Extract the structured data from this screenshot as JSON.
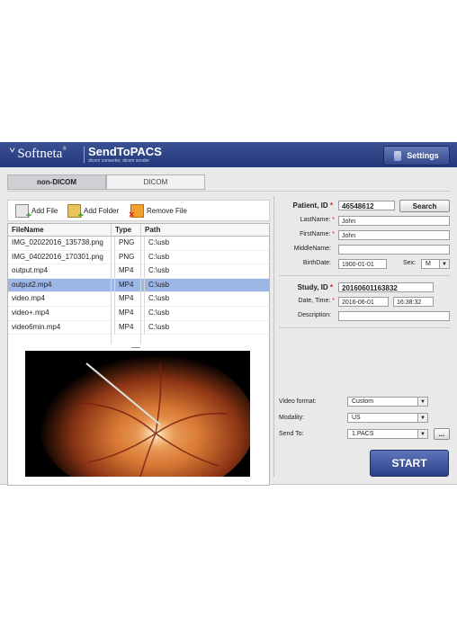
{
  "header": {
    "brand": "Softneta",
    "product": "SendToPACS",
    "product_sub": "dicom converter, dicom sender",
    "settings_label": "Settings"
  },
  "tabs": [
    {
      "label": "non-DICOM",
      "active": true
    },
    {
      "label": "DICOM",
      "active": false
    }
  ],
  "toolbar": {
    "add_file": "Add File",
    "add_folder": "Add Folder",
    "remove_file": "Remove File"
  },
  "table": {
    "headers": [
      "FileName",
      "Type",
      "Path"
    ],
    "rows": [
      {
        "name": "IMG_02022016_135738.png",
        "type": "PNG",
        "path": "C:\\usb",
        "selected": false
      },
      {
        "name": "IMG_04022016_170301.png",
        "type": "PNG",
        "path": "C:\\usb",
        "selected": false
      },
      {
        "name": "output.mp4",
        "type": "MP4",
        "path": "C:\\usb",
        "selected": false
      },
      {
        "name": "output2.mp4",
        "type": "MP4",
        "path": "C:\\usb",
        "selected": true
      },
      {
        "name": "video.mp4",
        "type": "MP4",
        "path": "C:\\usb",
        "selected": false
      },
      {
        "name": "video+.mp4",
        "type": "MP4",
        "path": "C:\\usb",
        "selected": false
      },
      {
        "name": "video6min.mp4",
        "type": "MP4",
        "path": "C:\\usb",
        "selected": false
      }
    ]
  },
  "patient": {
    "id_label": "Patient, ID",
    "id_value": "46548612",
    "search_label": "Search",
    "lastname_label": "LastName:",
    "lastname_value": "John",
    "firstname_label": "FirstName:",
    "firstname_value": "John",
    "middlename_label": "MiddleName:",
    "middlename_value": "",
    "birthdate_label": "BirthDate:",
    "birthdate_value": "1900-01-01",
    "sex_label": "Sex:",
    "sex_value": "M"
  },
  "study": {
    "id_label": "Study, ID",
    "id_value": "20160601163832",
    "datetime_label": "Date, Time:",
    "date_value": "2016-06-01",
    "time_value": "16:38:32",
    "description_label": "Description:",
    "description_value": ""
  },
  "send": {
    "video_format_label": "Video format:",
    "video_format_value": "Custom",
    "modality_label": "Modality:",
    "modality_value": "US",
    "send_to_label": "Send To:",
    "send_to_value": "1.PACS",
    "more_label": "...",
    "start_label": "START"
  },
  "colors": {
    "header": "#2c4185",
    "selected_row": "#9cb6e6",
    "required": "#d42020",
    "start": "#3b519a"
  }
}
